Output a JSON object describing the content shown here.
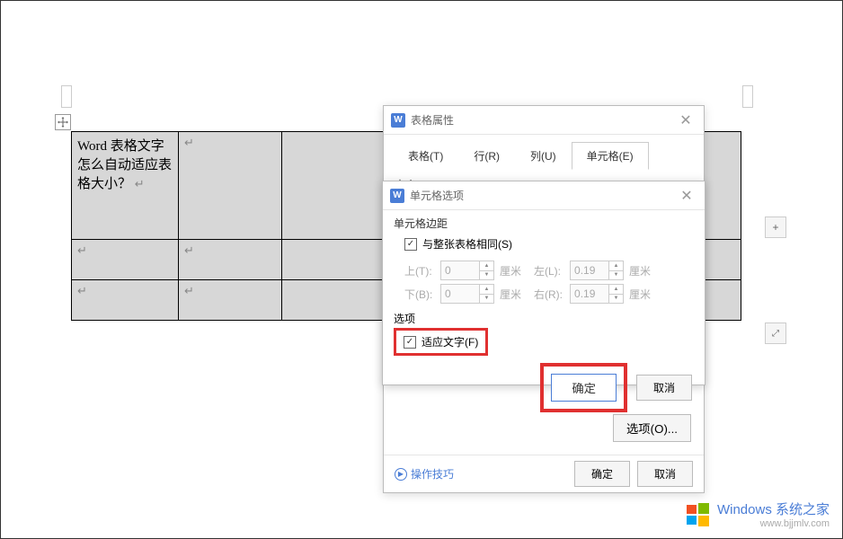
{
  "table": {
    "cell_text": "Word 表格文字怎么自动适应表格大小？",
    "para_mark": "↵"
  },
  "dialog_main": {
    "title": "表格属性",
    "tabs": {
      "table": "表格(T)",
      "row": "行(R)",
      "column": "列(U)",
      "cell": "单元格(E)"
    },
    "section_size": "大小",
    "options_btn": "选项(O)...",
    "tips": "操作技巧",
    "ok": "确定",
    "cancel": "取消"
  },
  "dialog_sub": {
    "title": "单元格选项",
    "margins_label": "单元格边距",
    "same_as_table": "与整张表格相同(S)",
    "top_label": "上(T):",
    "bottom_label": "下(B):",
    "left_label": "左(L):",
    "right_label": "右(R):",
    "top_val": "0",
    "bottom_val": "0",
    "left_val": "0.19",
    "right_val": "0.19",
    "unit": "厘米",
    "options_label": "选项",
    "fit_text": "适应文字(F)",
    "ok": "确定",
    "cancel": "取消"
  },
  "watermark": {
    "title": "Windows 系统之家",
    "url": "www.bjjmlv.com"
  }
}
